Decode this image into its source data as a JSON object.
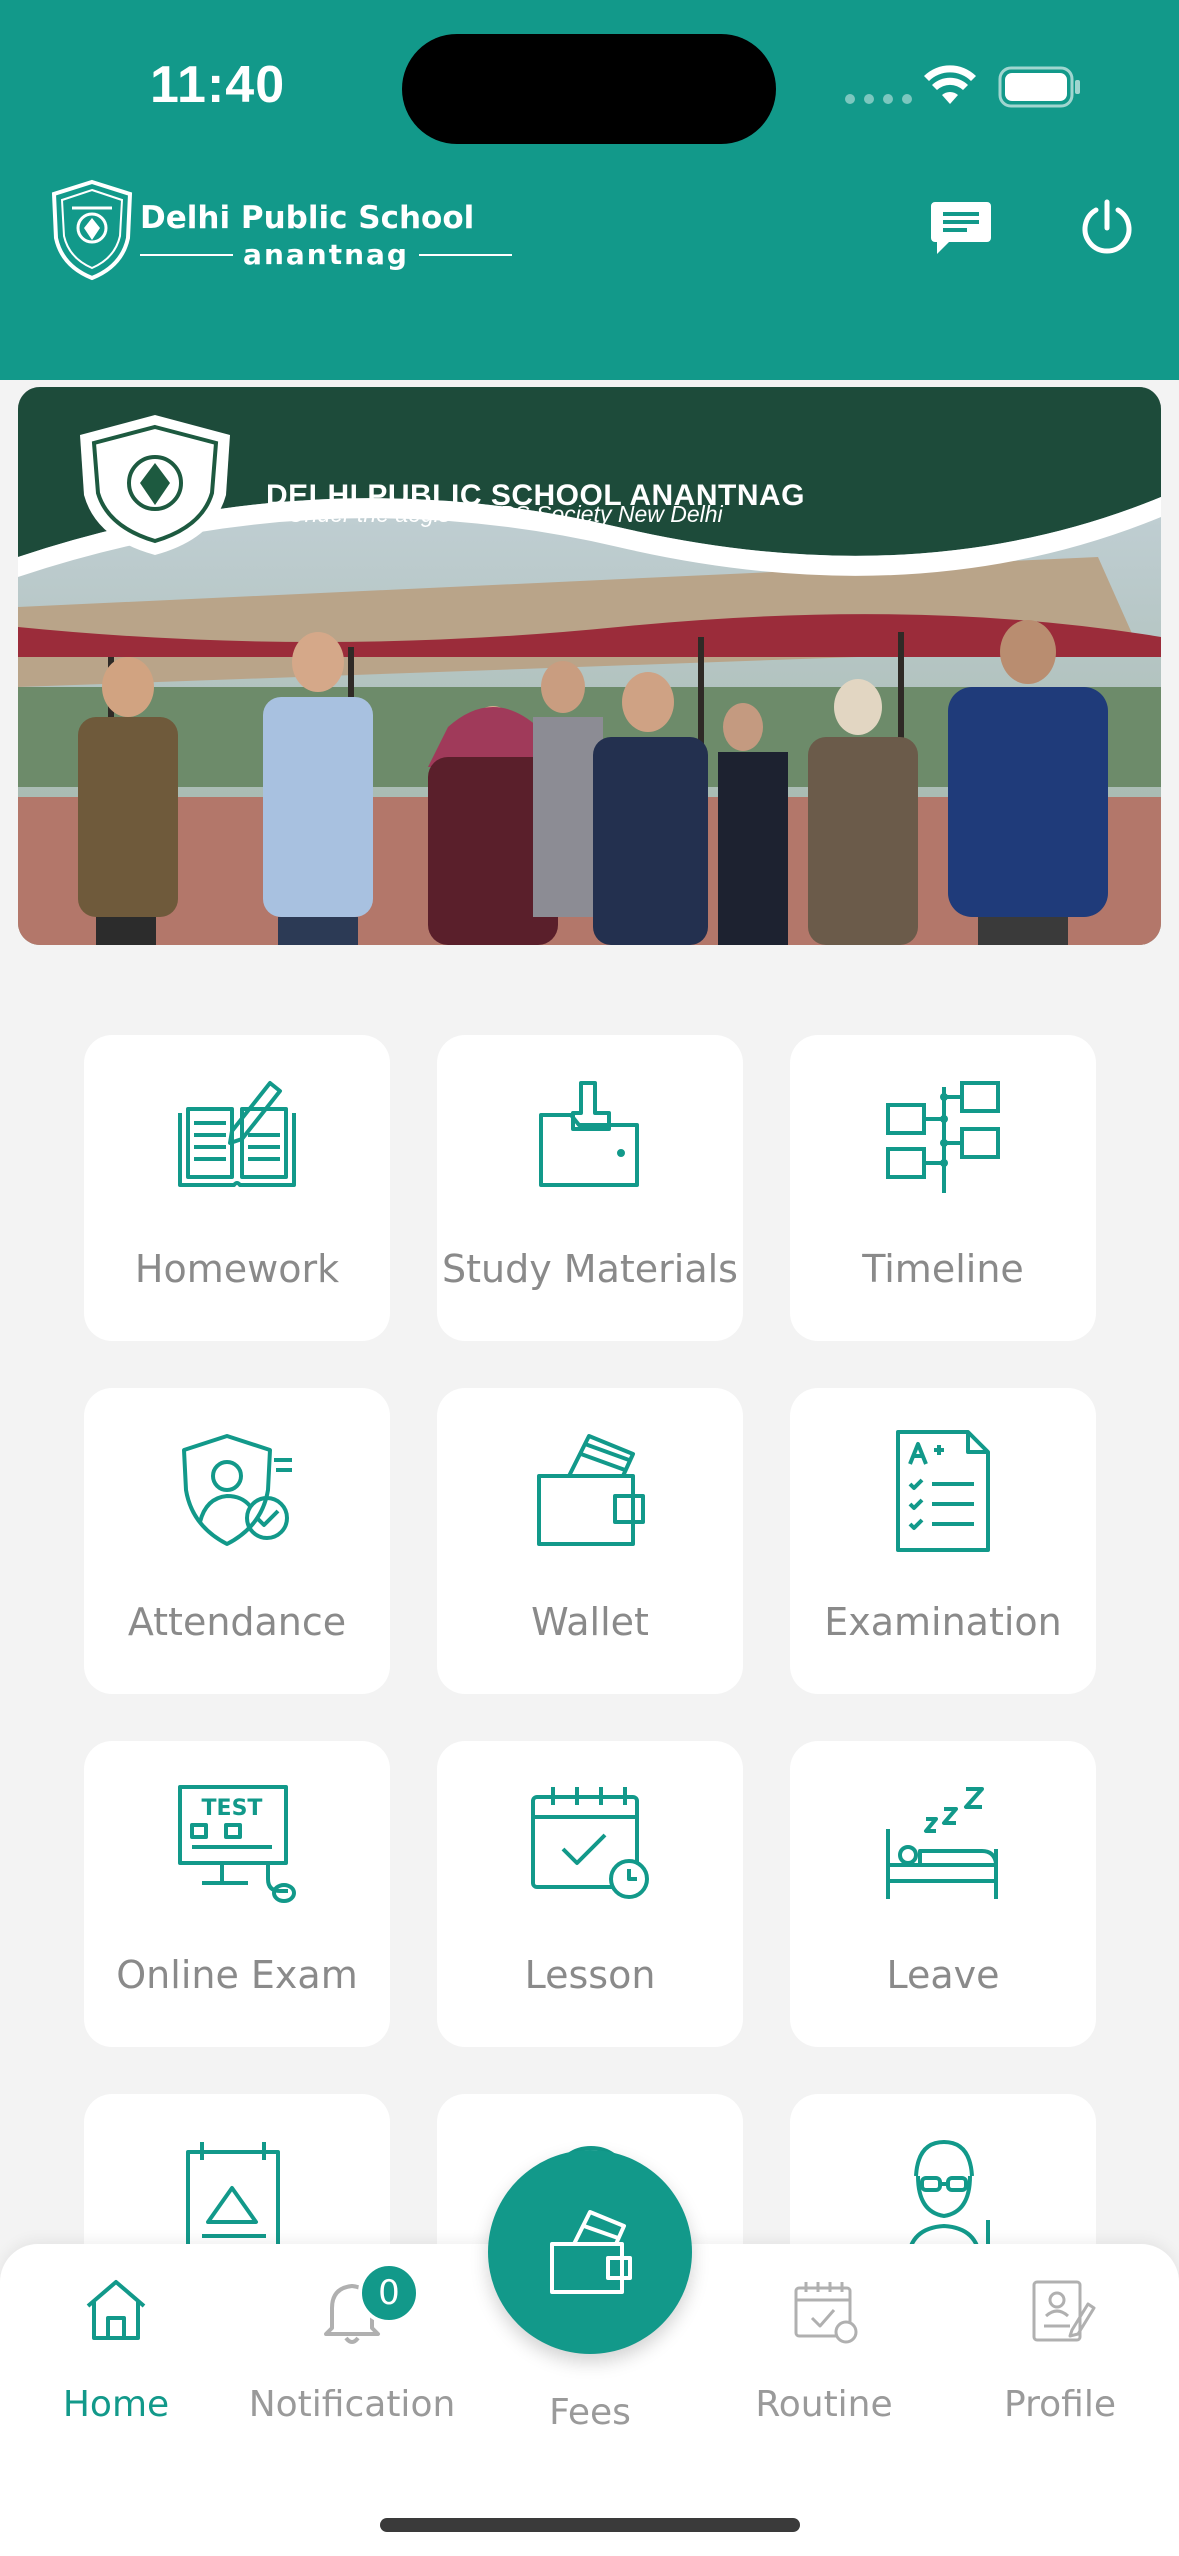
{
  "status_bar": {
    "time": "11:40"
  },
  "header": {
    "logo_title": "Delhi Public School",
    "logo_subtitle": "anantnag",
    "chat_icon": "chat-icon",
    "power_icon": "power-icon",
    "background_color": "#12998a"
  },
  "banner": {
    "title": "DELHI PUBLIC SCHOOL ANANTNAG",
    "subtitle": "Under the aegis of DPS Society New Delhi"
  },
  "menu": {
    "items": [
      {
        "label": "Homework",
        "icon": "homework-icon"
      },
      {
        "label": "Study Materials",
        "icon": "folder-icon"
      },
      {
        "label": "Timeline",
        "icon": "timeline-icon"
      },
      {
        "label": "Attendance",
        "icon": "attendance-icon"
      },
      {
        "label": "Wallet",
        "icon": "wallet-icon"
      },
      {
        "label": "Examination",
        "icon": "examination-icon"
      },
      {
        "label": "Online Exam",
        "icon": "online-exam-icon"
      },
      {
        "label": "Lesson",
        "icon": "calendar-icon"
      },
      {
        "label": "Leave",
        "icon": "leave-icon"
      },
      {
        "label": "",
        "icon": "board-icon"
      },
      {
        "label": "",
        "icon": "chat-bubble-icon"
      },
      {
        "label": "",
        "icon": "teacher-icon"
      }
    ]
  },
  "bottom_nav": {
    "home": "Home",
    "notification": "Notification",
    "notification_count": "0",
    "fees": "Fees",
    "routine": "Routine",
    "profile": "Profile",
    "accent_color": "#12998a"
  }
}
